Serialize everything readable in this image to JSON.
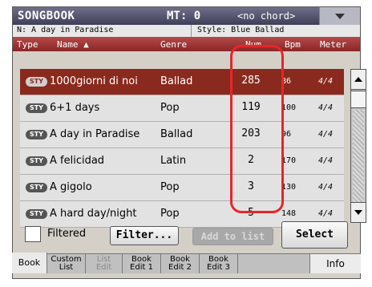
{
  "titlebar": {
    "title": "SONGBOOK",
    "mt": "MT: 0",
    "chord": "<no chord>"
  },
  "info": {
    "name": "N: A day in Paradise",
    "style": "Style: Blue Ballad"
  },
  "columns": {
    "type": "Type",
    "name": "Name ▲",
    "genre": "Genre",
    "num": "Num",
    "bpm": "Bpm",
    "meter": "Meter"
  },
  "rows": [
    {
      "badge": "STY",
      "name": "1000giorni di noi",
      "genre": "Ballad",
      "num": "285",
      "bpm": "86",
      "meter": "4/4",
      "selected": true
    },
    {
      "badge": "STY",
      "name": "6+1 days",
      "genre": "Pop",
      "num": "119",
      "bpm": "100",
      "meter": "4/4"
    },
    {
      "badge": "STY",
      "name": "A day in Paradise",
      "genre": "Ballad",
      "num": "203",
      "bpm": "96",
      "meter": "4/4"
    },
    {
      "badge": "STY",
      "name": "A felicidad",
      "genre": "Latin",
      "num": "2",
      "bpm": "170",
      "meter": "4/4"
    },
    {
      "badge": "STY",
      "name": "A gigolo",
      "genre": "Pop",
      "num": "3",
      "bpm": "130",
      "meter": "4/4"
    },
    {
      "badge": "STY",
      "name": "A hard day/night",
      "genre": "Pop",
      "num": "5",
      "bpm": "148",
      "meter": "4/4"
    }
  ],
  "controls": {
    "filtered_label": "Filtered",
    "filter_button": "Filter...",
    "add_button": "Add to list",
    "select_button": "Select"
  },
  "tabs": [
    {
      "l1": "Book",
      "l2": "",
      "active": true,
      "disabled": false
    },
    {
      "l1": "Custom",
      "l2": "List",
      "active": false,
      "disabled": false
    },
    {
      "l1": "List",
      "l2": "Edit",
      "active": false,
      "disabled": true
    },
    {
      "l1": "Book",
      "l2": "Edit 1",
      "active": false,
      "disabled": false
    },
    {
      "l1": "Book",
      "l2": "Edit 2",
      "active": false,
      "disabled": false
    },
    {
      "l1": "Book",
      "l2": "Edit 3",
      "active": false,
      "disabled": false
    }
  ],
  "info_tab": "Info",
  "colors": {
    "accent": "#8a2a1e",
    "header": "#9a3030",
    "highlight": "#e8252a",
    "titlebar": "#4a4a66"
  }
}
